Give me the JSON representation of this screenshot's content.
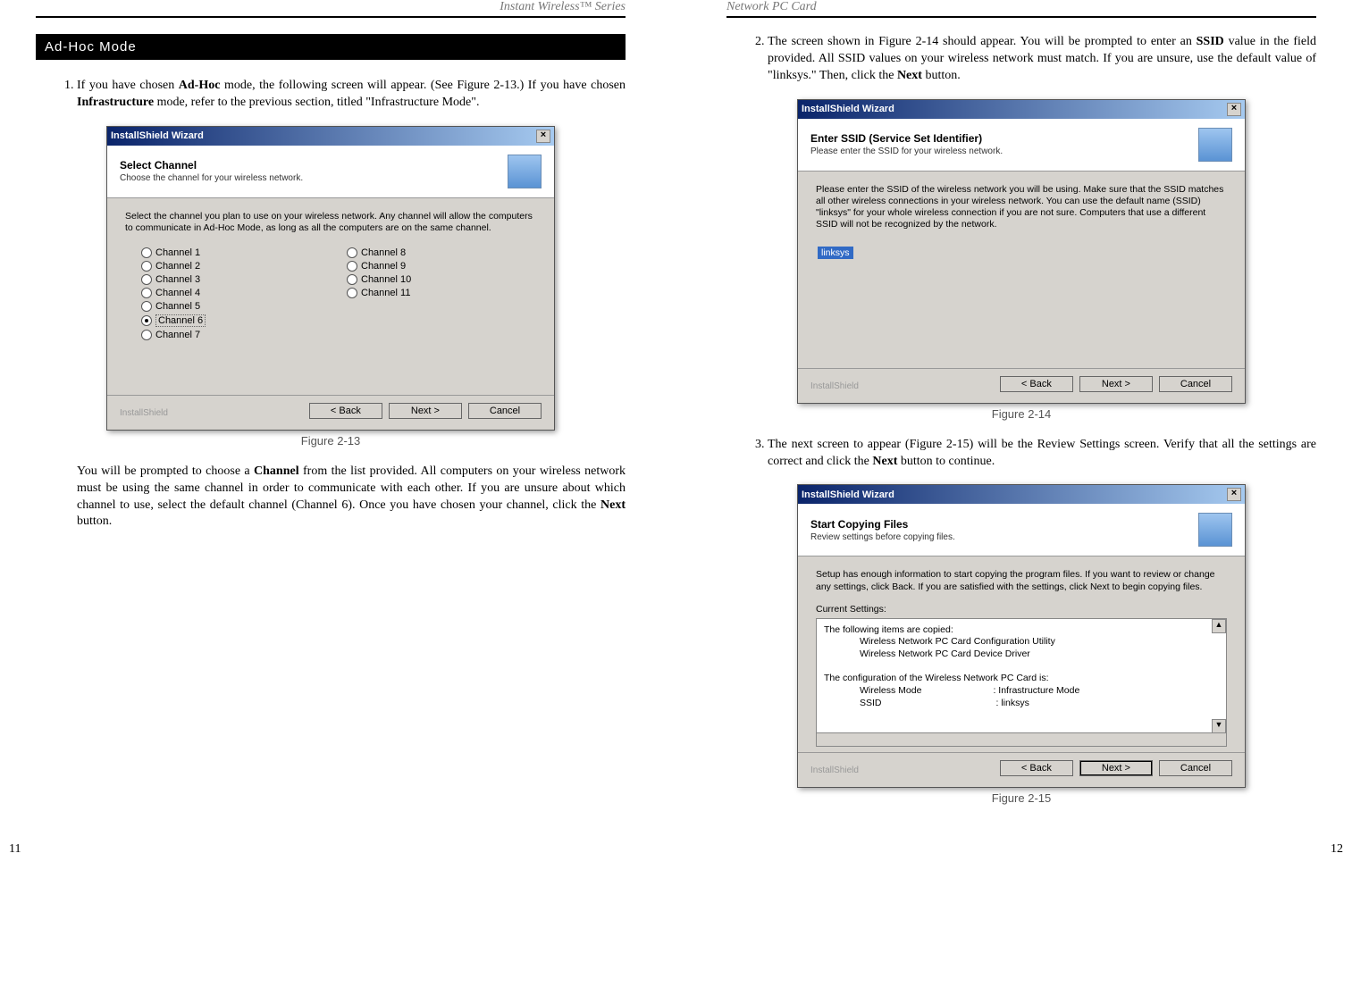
{
  "left": {
    "running_header": "Instant Wireless™ Series",
    "section_title": "Ad-Hoc Mode",
    "step1_pre": "If you have chosen ",
    "step1_bold1": "Ad-Hoc",
    "step1_mid": " mode, the following screen will appear. (See Figure 2-13.) If you have chosen ",
    "step1_bold2": "Infrastructure",
    "step1_end": " mode, refer to the previous section, titled \"Infrastructure Mode\".",
    "dialog": {
      "title": "InstallShield Wizard",
      "header_title": "Select Channel",
      "header_sub": "Choose the channel for your wireless network.",
      "desc": "Select the channel you plan to use on your wireless network. Any channel will allow the computers to communicate in Ad-Hoc Mode, as long as all the computers are on the same channel.",
      "channels_left": [
        "Channel 1",
        "Channel 2",
        "Channel 3",
        "Channel 4",
        "Channel 5",
        "Channel 6",
        "Channel 7"
      ],
      "channels_right": [
        "Channel 8",
        "Channel 9",
        "Channel 10",
        "Channel 11"
      ],
      "selected": "Channel 6",
      "footer_brand": "InstallShield",
      "back": "< Back",
      "next": "Next >",
      "cancel": "Cancel"
    },
    "fig_caption": "Figure 2-13",
    "para2_pre": "You will be prompted to choose a ",
    "para2_bold1": "Channel",
    "para2_mid": " from the list provided.   All computers on your wireless network must be using the same channel in order to communicate with each other.  If you are unsure about which channel to use, select the default channel (Channel 6).  Once you have chosen your channel, click the ",
    "para2_bold2": "Next",
    "para2_end": " button.",
    "page_num": "11"
  },
  "right": {
    "running_header": "Network PC Card",
    "step2_pre": "The screen shown in Figure 2-14 should appear.  You will be prompted to enter an ",
    "step2_bold1": "SSID",
    "step2_mid": " value in the field provided.   All SSID values on your wireless network must match.  If you are unsure, use the default value of \"linksys.\"  Then, click the ",
    "step2_bold2": "Next",
    "step2_end": " button.",
    "dialog14": {
      "title": "InstallShield Wizard",
      "header_title": "Enter SSID (Service Set Identifier)",
      "header_sub": "Please enter the SSID for your wireless network.",
      "desc": "Please enter the SSID of the wireless network you will be using. Make sure that the SSID matches all other wireless connections in your wireless network. You can use the default name (SSID) \"linksys\" for your whole wireless connection if you are not sure. Computers that use a different SSID will not be recognized by the network.",
      "ssid_value": "linksys",
      "footer_brand": "InstallShield",
      "back": "< Back",
      "next": "Next >",
      "cancel": "Cancel"
    },
    "fig14_caption": "Figure 2-14",
    "step3_pre": "The next screen to appear (Figure 2-15) will be the Review Settings screen. Verify that all the settings are correct and click the ",
    "step3_bold": "Next",
    "step3_end": " button to continue.",
    "dialog15": {
      "title": "InstallShield Wizard",
      "header_title": "Start Copying Files",
      "header_sub": "Review settings before copying files.",
      "desc": "Setup has enough information to start copying the program files.  If you want to review or change any settings, click Back.  If you are satisfied with the settings, click Next to begin copying files.",
      "current_label": "Current Settings:",
      "line1": "The following items are copied:",
      "line1a": "Wireless Network PC Card Configuration Utility",
      "line1b": "Wireless Network PC Card Device Driver",
      "line2": "The configuration of the Wireless Network PC Card is:",
      "line2a_k": "Wireless Mode",
      "line2a_v": ": Infrastructure Mode",
      "line2b_k": "SSID",
      "line2b_v": ": linksys",
      "footer_brand": "InstallShield",
      "back": "< Back",
      "next": "Next >",
      "cancel": "Cancel"
    },
    "fig15_caption": "Figure 2-15",
    "page_num": "12"
  }
}
